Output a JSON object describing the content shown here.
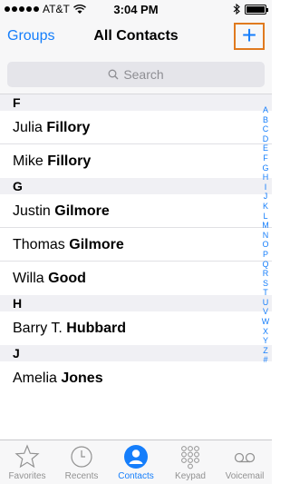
{
  "status_bar": {
    "carrier": "AT&T",
    "time": "3:04 PM"
  },
  "nav": {
    "left_label": "Groups",
    "title": "All Contacts",
    "add_label": "+"
  },
  "search": {
    "placeholder": "Search"
  },
  "sections": [
    {
      "letter": "F",
      "contacts": [
        {
          "first": "Julia",
          "last": "Fillory"
        },
        {
          "first": "Mike",
          "last": "Fillory"
        }
      ]
    },
    {
      "letter": "G",
      "contacts": [
        {
          "first": "Justin",
          "last": "Gilmore"
        },
        {
          "first": "Thomas",
          "last": "Gilmore"
        },
        {
          "first": "Willa",
          "last": "Good"
        }
      ]
    },
    {
      "letter": "H",
      "contacts": [
        {
          "first": "Barry T.",
          "last": "Hubbard"
        }
      ]
    },
    {
      "letter": "J",
      "contacts": [
        {
          "first": "Amelia",
          "last": "Jones"
        }
      ]
    }
  ],
  "index_letters": [
    "A",
    "B",
    "C",
    "D",
    "E",
    "F",
    "G",
    "H",
    "I",
    "J",
    "K",
    "L",
    "M",
    "N",
    "O",
    "P",
    "Q",
    "R",
    "S",
    "T",
    "U",
    "V",
    "W",
    "X",
    "Y",
    "Z",
    "#"
  ],
  "tabs": [
    {
      "label": "Favorites",
      "icon": "star-icon",
      "active": false
    },
    {
      "label": "Recents",
      "icon": "clock-icon",
      "active": false
    },
    {
      "label": "Contacts",
      "icon": "person-icon",
      "active": true
    },
    {
      "label": "Keypad",
      "icon": "keypad-icon",
      "active": false
    },
    {
      "label": "Voicemail",
      "icon": "voicemail-icon",
      "active": false
    }
  ],
  "colors": {
    "accent": "#157efb",
    "highlight_border": "#e07a1f",
    "inactive": "#929292"
  }
}
